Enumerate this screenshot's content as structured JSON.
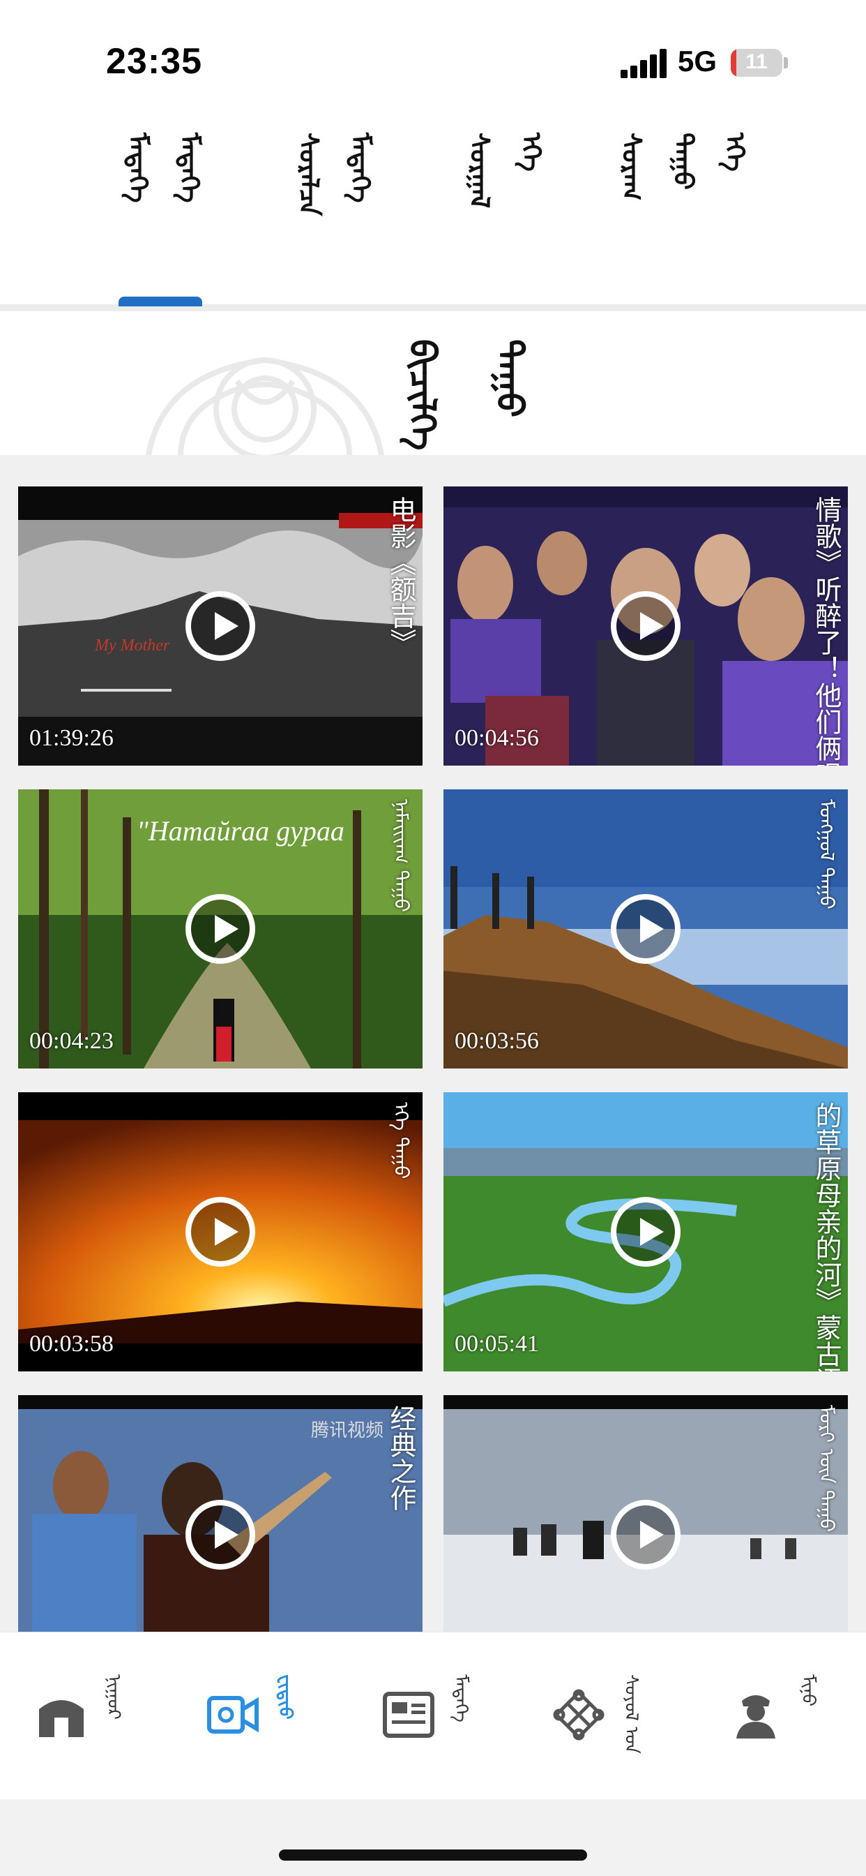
{
  "status_bar": {
    "time": "23:35",
    "network": "5G",
    "battery_level": "11",
    "battery_fraction": 0.11,
    "battery_color": "#e23b34"
  },
  "tabs": {
    "items": [
      {
        "label": [
          "ᠮᠡᠳᠡᠭᠡ",
          "ᠮᠡᠳᠡᠭᠡ"
        ]
      },
      {
        "label": [
          "ᠰᠤᠷᠠᠯᠴᠠ",
          "ᠮᠡᠳᠡᠭᠡ"
        ]
      },
      {
        "label": [
          "ᠰᠤᠷᠭᠠᠯ",
          "ᠡᠬᠡ"
        ]
      },
      {
        "label": [
          "ᠰᠤᠷᠠᠭ",
          "ᠳᠠᠭᠤ",
          "ᠡᠬᠡ"
        ]
      }
    ],
    "active_index": 0,
    "accent": "#1f6fc2"
  },
  "section": {
    "title": [
      "ᠪᠢᠴᠢᠯᠭᠡ",
      "ᠳᠠᠭᠤ"
    ]
  },
  "videos": [
    {
      "duration": "01:39:26",
      "caption": "电影《额吉》",
      "overlay": "My Mother",
      "script": "cjk"
    },
    {
      "duration": "00:04:56",
      "caption": "情歌》听醉了！他们俩唱的《蒙古",
      "script": "cjk"
    },
    {
      "duration": "00:04:23",
      "caption": "ᠨᠠᠮᠠᠢᠢᠠᠭ ᠳᠠᠭᠤ",
      "overlay": "\"Hamaŭraa gypaa",
      "script": "mgl"
    },
    {
      "duration": "00:03:56",
      "caption": "ᠮᠣᠩᠭᠣᠯ ᠳᠠᠭᠤ",
      "script": "mgl"
    },
    {
      "duration": "00:03:58",
      "caption": "ᠡᠬᠡ ᠳᠠᠭᠤ",
      "script": "mgl"
    },
    {
      "duration": "00:05:41",
      "caption": "的草原母亲的河》蒙古语版的《父亲",
      "script": "cjk"
    },
    {
      "duration": "",
      "caption": "经典之作",
      "watermark": "腾讯视频",
      "script": "cjk"
    },
    {
      "duration": "",
      "caption": "ᠮᠣᠷᠢ ᠦᠨ ᠳᠠᠭᠤ",
      "script": "mgl"
    }
  ],
  "bottom_nav": {
    "items": [
      {
        "icon": "yurt-home-icon",
        "label": "ᠨᠢᠭᠤᠷ"
      },
      {
        "icon": "video-camera-icon",
        "label": "ᠸᠢᠳᠢᠣ"
      },
      {
        "icon": "news-card-icon",
        "label": "ᠮᠡᠳᠡᠭᠡ"
      },
      {
        "icon": "endless-knot-icon",
        "label": "ᠰᠣᠶᠣᠯ ᠤᠨ"
      },
      {
        "icon": "user-profile-icon",
        "label": "ᠮᠢᠨᠦ"
      }
    ],
    "active_index": 1,
    "active_color": "#2b8fe0"
  }
}
